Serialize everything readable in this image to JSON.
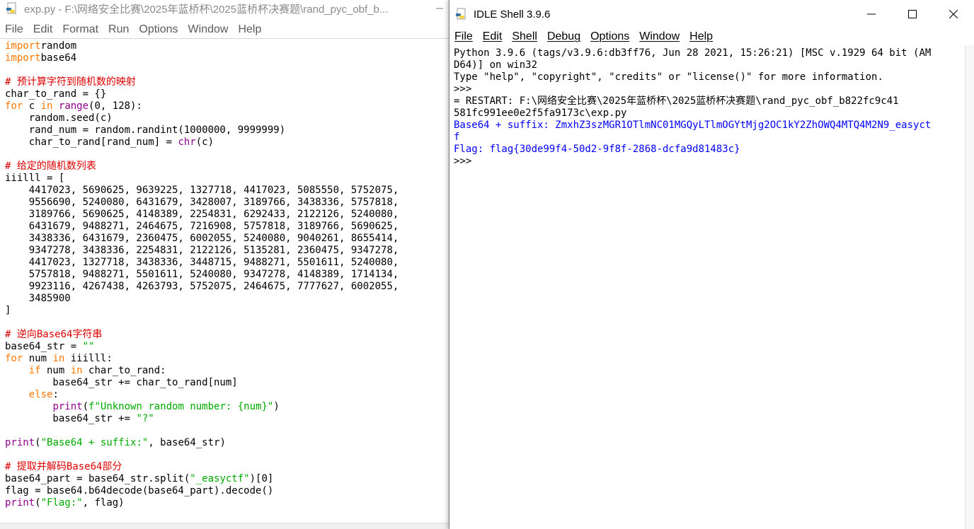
{
  "editor": {
    "title": "exp.py - F:\\网络安全比赛\\2025年蓝桥杯\\2025蓝桥杯决赛题\\rand_pyc_obf_b...",
    "menu": [
      "File",
      "Edit",
      "Format",
      "Run",
      "Options",
      "Window",
      "Help"
    ],
    "code_lines": [
      [
        [
          "kw",
          "import"
        ],
        [
          "",
          "random"
        ]
      ],
      [
        [
          "kw",
          "import"
        ],
        [
          "",
          "base64"
        ]
      ],
      [],
      [
        [
          "cm",
          "# 预计算字符到随机数的映射"
        ]
      ],
      [
        [
          "",
          "char_to_rand = {}"
        ]
      ],
      [
        [
          "kw",
          "for"
        ],
        [
          "",
          " c "
        ],
        [
          "kw",
          "in"
        ],
        [
          "",
          " "
        ],
        [
          "bi",
          "range"
        ],
        [
          "",
          "(0, 128):"
        ]
      ],
      [
        [
          "",
          "    random.seed(c)"
        ]
      ],
      [
        [
          "",
          "    rand_num = random.randint(1000000, 9999999)"
        ]
      ],
      [
        [
          "",
          "    char_to_rand[rand_num] = "
        ],
        [
          "bi",
          "chr"
        ],
        [
          "",
          "(c)"
        ]
      ],
      [],
      [
        [
          "cm",
          "# 给定的随机数列表"
        ]
      ],
      [
        [
          "",
          "iiilll = ["
        ]
      ],
      [
        [
          "",
          "    4417023, 5690625, 9639225, 1327718, 4417023, 5085550, 5752075,"
        ]
      ],
      [
        [
          "",
          "    9556690, 5240080, 6431679, 3428007, 3189766, 3438336, 5757818,"
        ]
      ],
      [
        [
          "",
          "    3189766, 5690625, 4148389, 2254831, 6292433, 2122126, 5240080,"
        ]
      ],
      [
        [
          "",
          "    6431679, 9488271, 2464675, 7216908, 5757818, 3189766, 5690625,"
        ]
      ],
      [
        [
          "",
          "    3438336, 6431679, 2360475, 6002055, 5240080, 9040261, 8655414,"
        ]
      ],
      [
        [
          "",
          "    9347278, 3438336, 2254831, 2122126, 5135281, 2360475, 9347278,"
        ]
      ],
      [
        [
          "",
          "    4417023, 1327718, 3438336, 3448715, 9488271, 5501611, 5240080,"
        ]
      ],
      [
        [
          "",
          "    5757818, 9488271, 5501611, 5240080, 9347278, 4148389, 1714134,"
        ]
      ],
      [
        [
          "",
          "    9923116, 4267438, 4263793, 5752075, 2464675, 7777627, 6002055,"
        ]
      ],
      [
        [
          "",
          "    3485900"
        ]
      ],
      [
        [
          "",
          "]"
        ]
      ],
      [],
      [
        [
          "cm",
          "# 逆向Base64字符串"
        ]
      ],
      [
        [
          "",
          "base64_str = "
        ],
        [
          "str",
          "\"\""
        ]
      ],
      [
        [
          "kw",
          "for"
        ],
        [
          "",
          " num "
        ],
        [
          "kw",
          "in"
        ],
        [
          "",
          " iiilll:"
        ]
      ],
      [
        [
          "",
          "    "
        ],
        [
          "kw",
          "if"
        ],
        [
          "",
          " num "
        ],
        [
          "kw",
          "in"
        ],
        [
          "",
          " char_to_rand:"
        ]
      ],
      [
        [
          "",
          "        base64_str += char_to_rand[num]"
        ]
      ],
      [
        [
          "",
          "    "
        ],
        [
          "kw",
          "else"
        ],
        [
          "",
          ":"
        ]
      ],
      [
        [
          "",
          "        "
        ],
        [
          "bi",
          "print"
        ],
        [
          "",
          "("
        ],
        [
          "str",
          "f\"Unknown random number: {num}\""
        ],
        [
          "",
          ")"
        ]
      ],
      [
        [
          "",
          "        base64_str += "
        ],
        [
          "str",
          "\"?\""
        ]
      ],
      [],
      [
        [
          "bi",
          "print"
        ],
        [
          "",
          "("
        ],
        [
          "str",
          "\"Base64 + suffix:\""
        ],
        [
          "",
          ", base64_str)"
        ]
      ],
      [],
      [
        [
          "cm",
          "# 提取并解码Base64部分"
        ]
      ],
      [
        [
          "",
          "base64_part = base64_str.split("
        ],
        [
          "str",
          "\"_easyctf\""
        ],
        [
          "",
          ")[0]"
        ]
      ],
      [
        [
          "",
          "flag = base64.b64decode(base64_part).decode()"
        ]
      ],
      [
        [
          "bi",
          "print"
        ],
        [
          "",
          "("
        ],
        [
          "str",
          "\"Flag:\""
        ],
        [
          "",
          ", flag)"
        ]
      ]
    ]
  },
  "shell": {
    "title": "IDLE Shell 3.9.6",
    "menu": [
      "File",
      "Edit",
      "Shell",
      "Debug",
      "Options",
      "Window",
      "Help"
    ],
    "lines": [
      [
        [
          "",
          "Python 3.9.6 (tags/v3.9.6:db3ff76, Jun 28 2021, 15:26:21) [MSC v.1929 64 bit (AM"
        ]
      ],
      [
        [
          "",
          "D64)] on win32"
        ]
      ],
      [
        [
          "",
          "Type \"help\", \"copyright\", \"credits\" or \"license()\" for more information."
        ]
      ],
      [
        [
          "prompt",
          ">>>"
        ]
      ],
      [
        [
          "",
          "= RESTART: F:\\网络安全比赛\\2025年蓝桥杯\\2025蓝桥杯决赛题\\rand_pyc_obf_b822fc9c41"
        ]
      ],
      [
        [
          "",
          "581fc991ee0e2f5fa9173c\\exp.py"
        ]
      ],
      [
        [
          "out",
          "Base64 + suffix: ZmxhZ3szMGR1OTlmNC01MGQyLTlmOGYtMjg2OC1kY2ZhOWQ4MTQ4M2N9_easyct"
        ]
      ],
      [
        [
          "out",
          "f"
        ]
      ],
      [
        [
          "out",
          "Flag: flag{30de99f4-50d2-9f8f-2868-dcfa9d81483c}"
        ]
      ],
      [
        [
          "prompt",
          ">>>"
        ]
      ]
    ]
  },
  "colors": {
    "keyword": "#ff7700",
    "builtin": "#900090",
    "string": "#00aa00",
    "comment": "#dd0000",
    "stdout": "#0000ff"
  },
  "icons": {
    "app": "idle-python-icon",
    "minimize": "minimize-icon",
    "maximize": "maximize-icon",
    "close": "close-icon"
  }
}
